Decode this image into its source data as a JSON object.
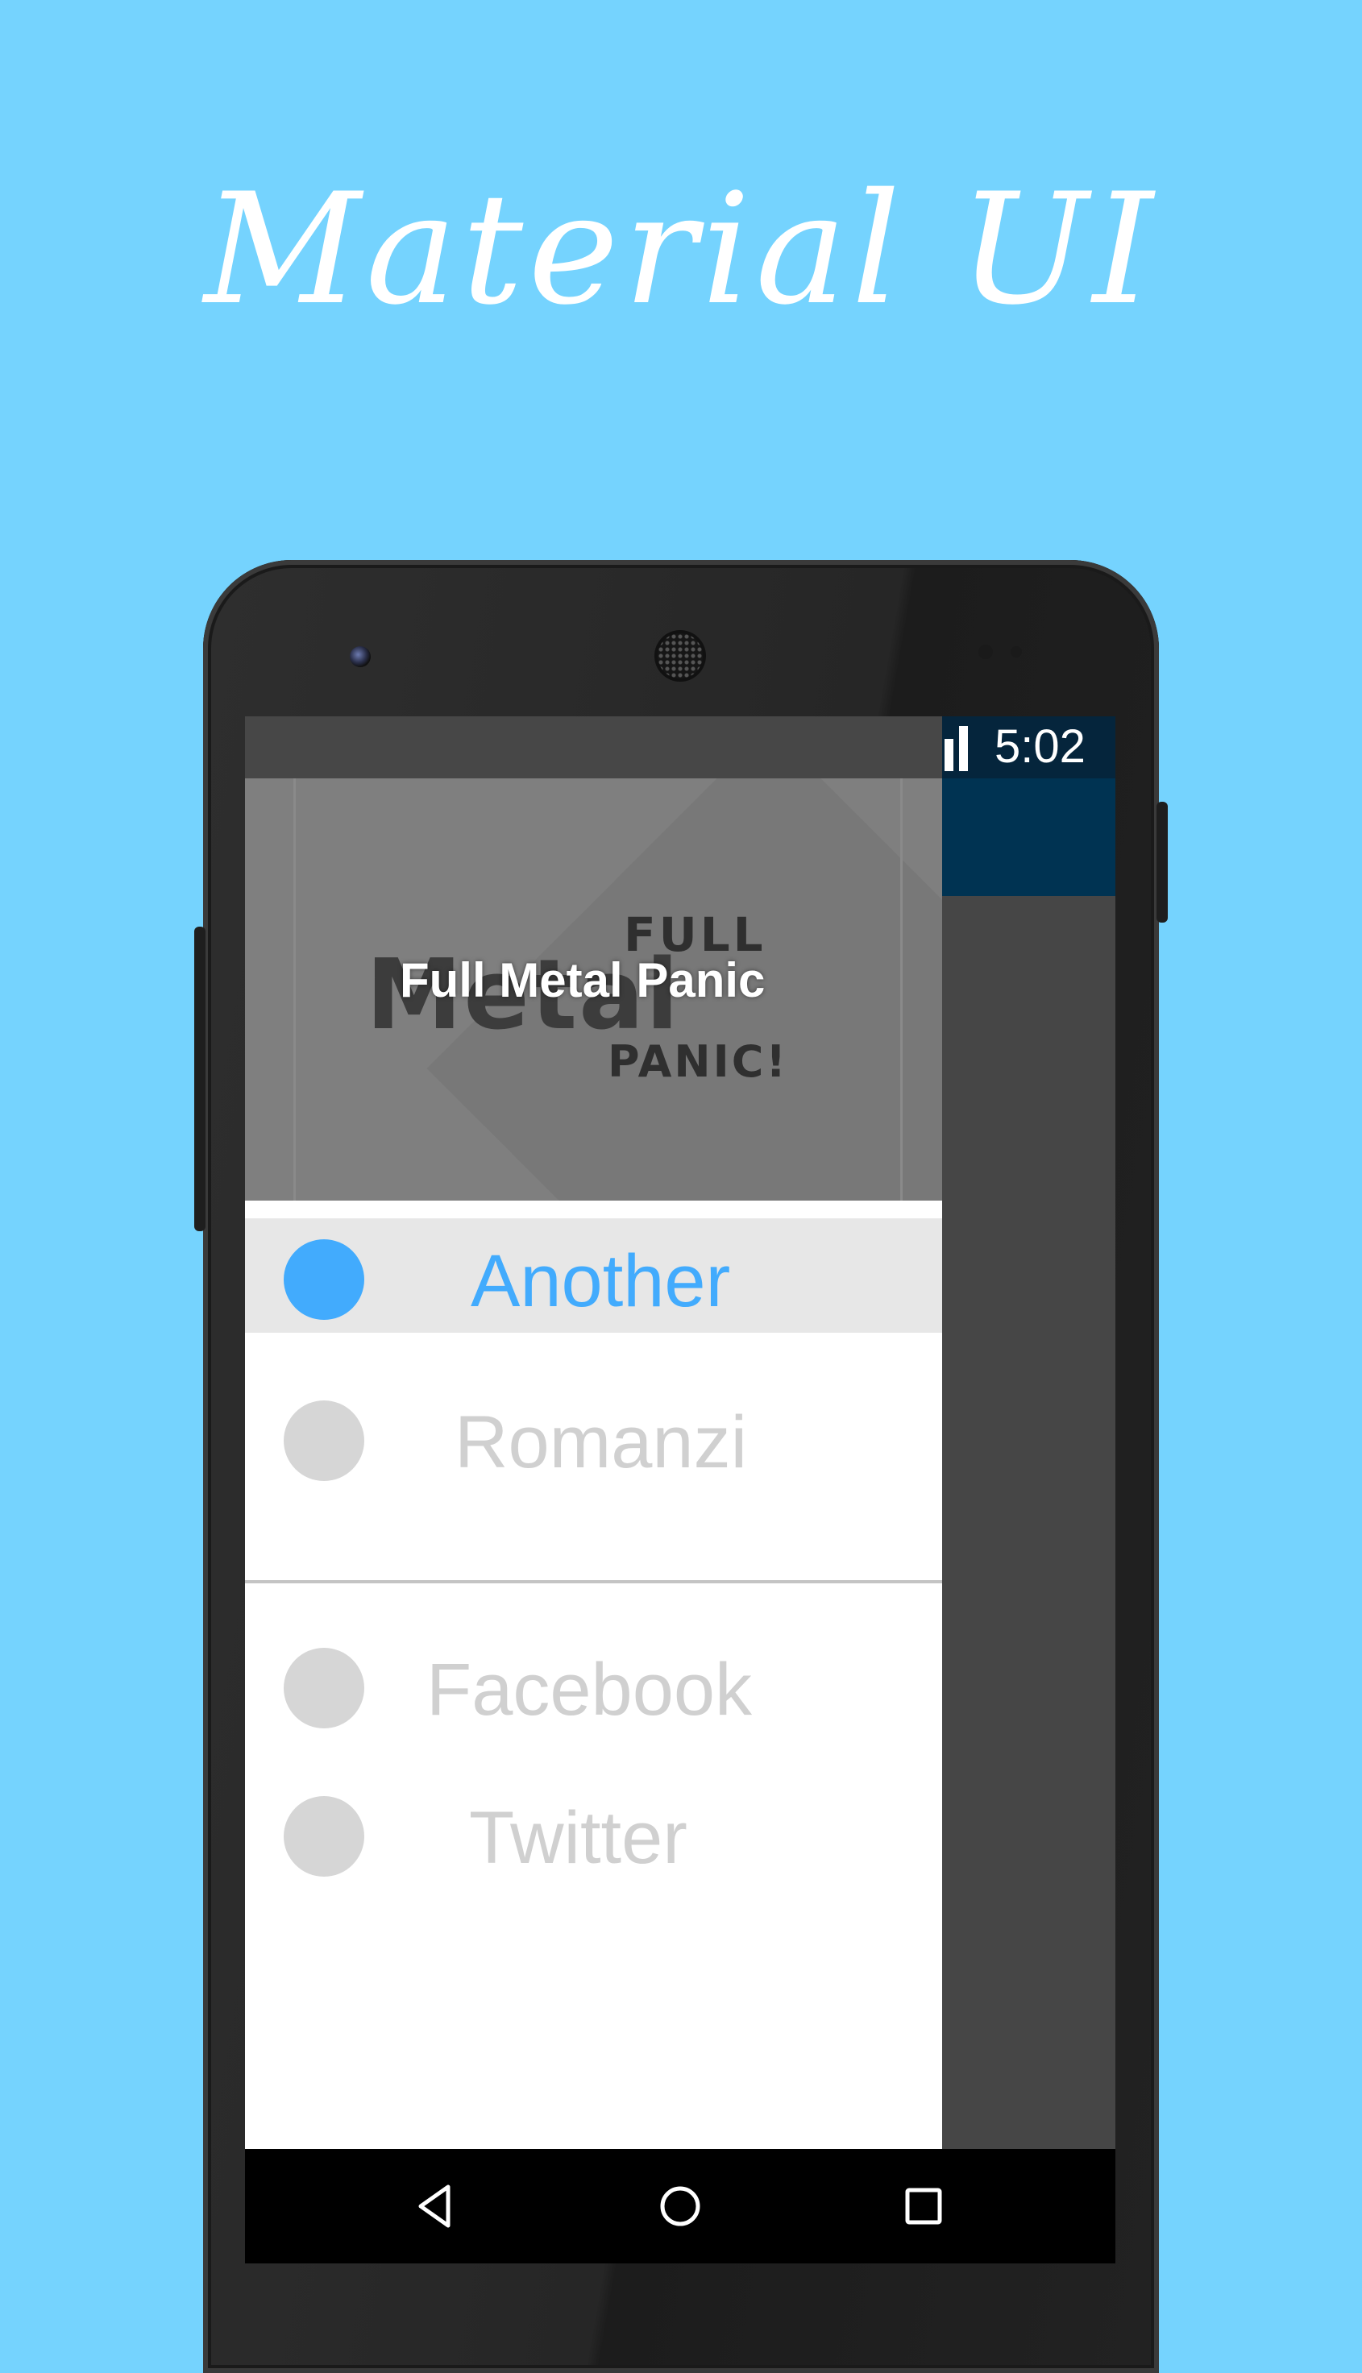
{
  "headline": "Material UI",
  "status_bar": {
    "time": "5:02"
  },
  "drawer": {
    "header_title": "Full Metal Panic",
    "logo": {
      "top": "FULL",
      "middle": "Metal",
      "bottom": "PANIC!"
    },
    "items": [
      {
        "label": "Another",
        "active": true
      },
      {
        "label": "Romanzi",
        "active": false
      },
      {
        "label": "Facebook",
        "active": false
      },
      {
        "label": "Twitter",
        "active": false
      }
    ]
  },
  "colors": {
    "background": "#75d3fe",
    "accent": "#42abfd",
    "toolbar": "#003352",
    "inactive": "#d6d6d6"
  },
  "icons": [
    "signal-icon",
    "back-icon",
    "home-icon",
    "recents-icon"
  ]
}
